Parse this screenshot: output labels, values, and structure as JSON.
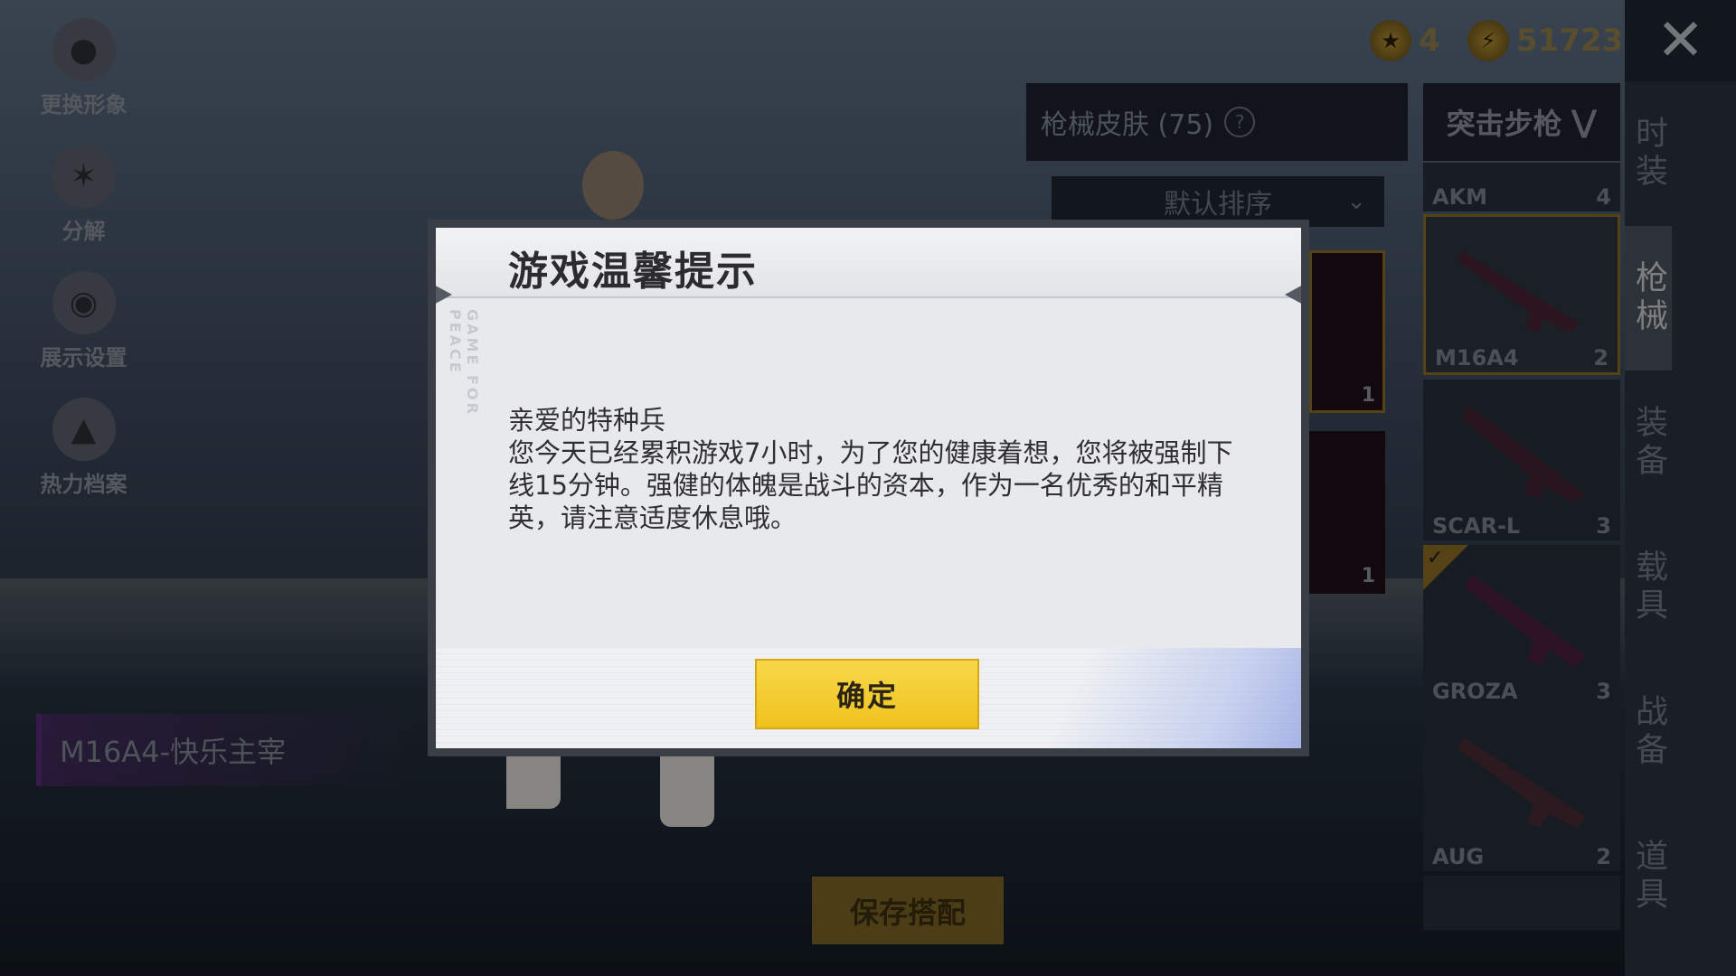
{
  "left_menu": [
    {
      "label": "更换形象",
      "icon": "avatar-icon"
    },
    {
      "label": "分解",
      "icon": "puzzle-icon"
    },
    {
      "label": "展示设置",
      "icon": "eye-icon"
    },
    {
      "label": "热力档案",
      "icon": "flame-icon"
    }
  ],
  "currency": {
    "tokens": "4",
    "coins": "51723"
  },
  "skins_panel": {
    "title": "枪械皮肤 (75)",
    "help": "?",
    "sort": "默认排序",
    "cards": [
      {
        "count": "1"
      },
      {
        "count": "1"
      }
    ]
  },
  "category": {
    "label": "突击步枪"
  },
  "weapons": [
    {
      "name": "AKM",
      "count": "4"
    },
    {
      "name": "M16A4",
      "count": "2",
      "selected": true
    },
    {
      "name": "SCAR-L",
      "count": "3"
    },
    {
      "name": "GROZA",
      "count": "3",
      "equipped": true
    },
    {
      "name": "AUG",
      "count": "2"
    }
  ],
  "side_tabs": [
    "时装",
    "枪械",
    "装备",
    "载具",
    "战备",
    "道具"
  ],
  "active_side_tab": "枪械",
  "skin_name": "M16A4-快乐主宰",
  "save_button": "保存搭配",
  "dialog": {
    "title": "游戏温馨提示",
    "side_text": "GAME FOR PEACE",
    "greeting": "亲爱的特种兵",
    "message": "您今天已经累积游戏7小时，为了您的健康着想，您将被强制下线15分钟。强健的体魄是战斗的资本，作为一名优秀的和平精英，请注意适度休息哦。",
    "confirm": "确定"
  },
  "colors": {
    "accent_gold": "#f0c21c",
    "selected_border": "#8a6c24"
  }
}
